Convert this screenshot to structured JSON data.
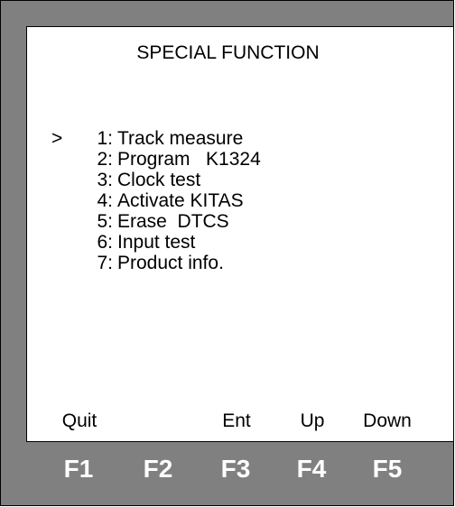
{
  "screen": {
    "title": "SPECIAL FUNCTION",
    "cursor": ">",
    "menu_items": [
      {
        "number": "1:",
        "label": "Track measure"
      },
      {
        "number": "2:",
        "label": "Program   K1324"
      },
      {
        "number": "3:",
        "label": "Clock test"
      },
      {
        "number": "4:",
        "label": "Activate KITAS"
      },
      {
        "number": "5:",
        "label": "Erase  DTCS"
      },
      {
        "number": "6:",
        "label": "Input test"
      },
      {
        "number": "7:",
        "label": "Product info."
      }
    ],
    "selected_index": 0,
    "softkey_labels": {
      "f1": "Quit",
      "f2": "",
      "f3": "Ent",
      "f4": "Up",
      "f5": "Down"
    }
  },
  "function_keys": [
    "F1",
    "F2",
    "F3",
    "F4",
    "F5"
  ],
  "colors": {
    "bezel": "#808080",
    "screen_background": "#ffffff",
    "text": "#000000",
    "key_label": "#ffffff"
  }
}
